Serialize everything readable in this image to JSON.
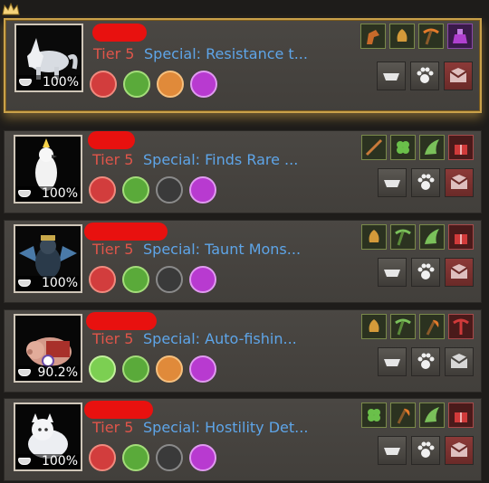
{
  "pets": [
    {
      "tier": "Tier 5",
      "special": "Special: Resistance t...",
      "hunger": "100%",
      "skills": [
        "red",
        "green",
        "orange",
        "purple"
      ],
      "traits": [
        "horse-icon",
        "bell-icon",
        "pick-icon",
        "potion-icon"
      ]
    },
    {
      "tier": "Tier 5",
      "special": "Special: Finds Rare ...",
      "hunger": "100%",
      "skills": [
        "red",
        "green",
        "grey",
        "purple"
      ],
      "traits": [
        "rod-icon",
        "clover-icon",
        "wing-icon",
        "gift-icon"
      ]
    },
    {
      "tier": "Tier 5",
      "special": "Special: Taunt Mons...",
      "hunger": "100%",
      "skills": [
        "red",
        "green",
        "grey",
        "purple"
      ],
      "traits": [
        "bell-icon",
        "pick-icon",
        "wing-icon",
        "gift-icon"
      ]
    },
    {
      "tier": "Tier 5",
      "special": "Special: Auto-fishin...",
      "hunger": "90.2%",
      "skills": [
        "lgreen",
        "green",
        "orange",
        "purple"
      ],
      "traits": [
        "bell-icon",
        "pick-icon",
        "axe-icon",
        "pickaxe-icon"
      ]
    },
    {
      "tier": "Tier 5",
      "special": "Special: Hostility Det...",
      "hunger": "100%",
      "skills": [
        "red",
        "green",
        "grey",
        "purple"
      ],
      "traits": [
        "clover-icon",
        "axe-icon",
        "wing-icon",
        "gift-icon"
      ]
    }
  ],
  "colors": {
    "tier": "#e0554a",
    "special": "#5ea5e8",
    "featured_border": "#c9a14a",
    "redaction": "#e8110f"
  }
}
